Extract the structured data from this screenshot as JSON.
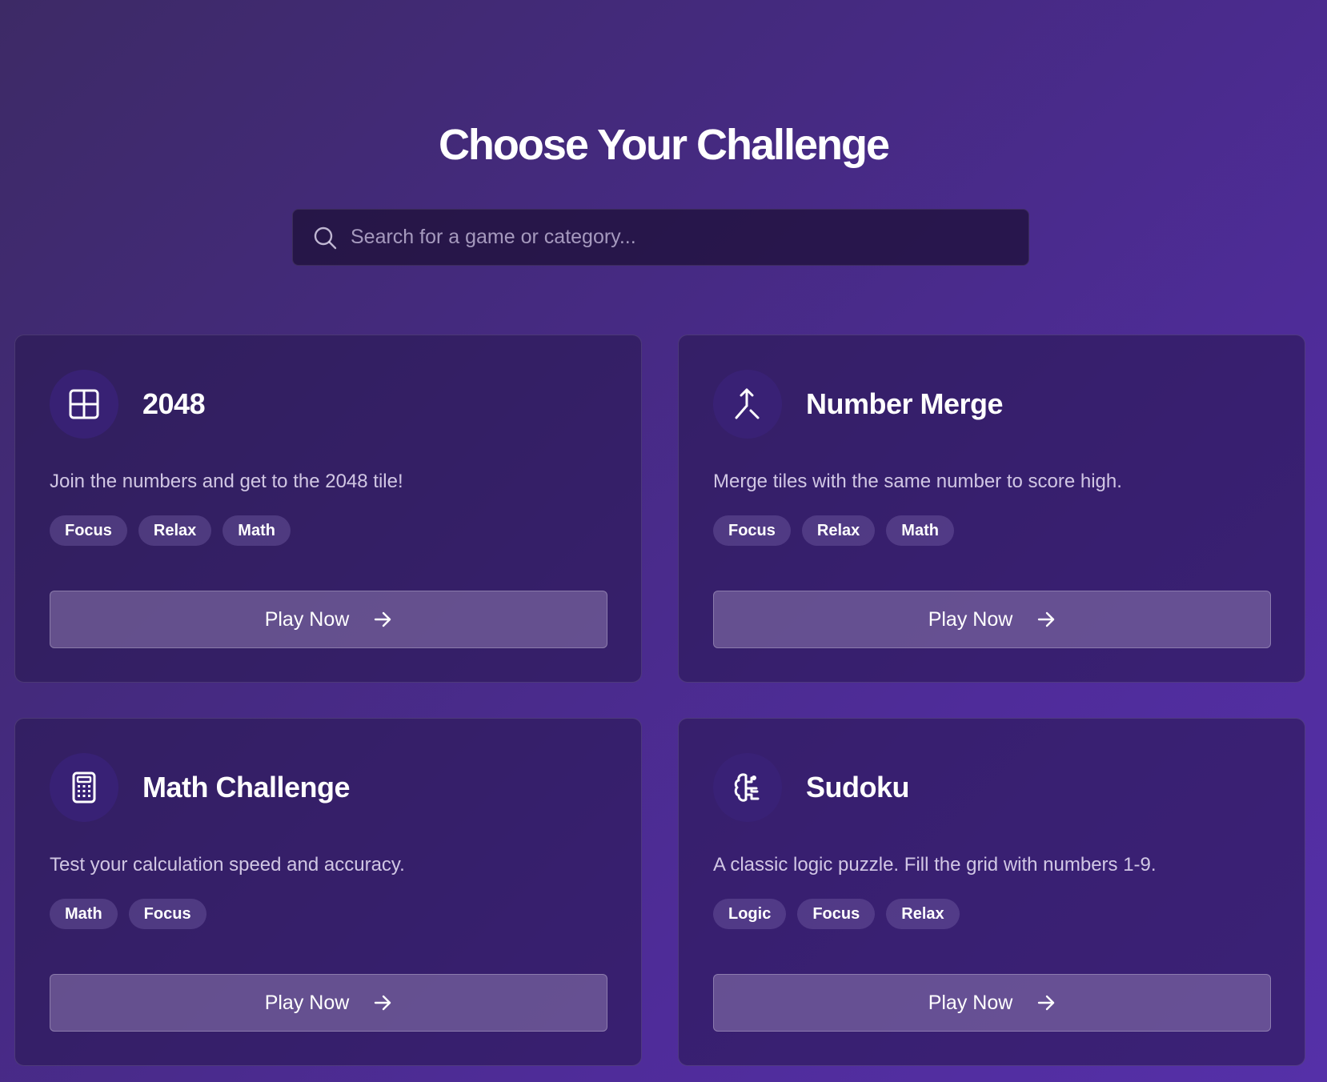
{
  "header": {
    "title": "Choose Your Challenge"
  },
  "search": {
    "placeholder": "Search for a game or category...",
    "icon": "search-icon"
  },
  "games": [
    {
      "title": "2048",
      "icon": "grid-icon",
      "description": "Join the numbers and get to the 2048 tile!",
      "tags": [
        "Focus",
        "Relax",
        "Math"
      ],
      "play_label": "Play Now"
    },
    {
      "title": "Number Merge",
      "icon": "merge-icon",
      "description": "Merge tiles with the same number to score high.",
      "tags": [
        "Focus",
        "Relax",
        "Math"
      ],
      "play_label": "Play Now"
    },
    {
      "title": "Math Challenge",
      "icon": "calculator-icon",
      "description": "Test your calculation speed and accuracy.",
      "tags": [
        "Math",
        "Focus"
      ],
      "play_label": "Play Now"
    },
    {
      "title": "Sudoku",
      "icon": "brain-icon",
      "description": "A classic logic puzzle. Fill the grid with numbers 1-9.",
      "tags": [
        "Logic",
        "Focus",
        "Relax"
      ],
      "play_label": "Play Now"
    }
  ]
}
